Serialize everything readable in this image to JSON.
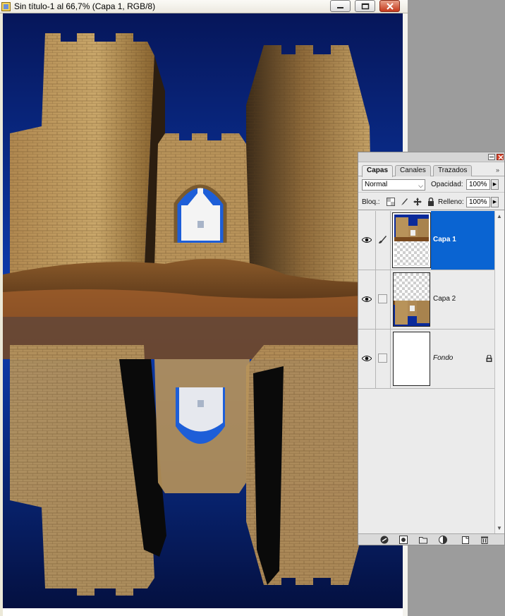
{
  "window": {
    "title": "Sin título-1 al 66,7% (Capa 1, RGB/8)"
  },
  "layers_panel": {
    "tabs": [
      {
        "label": "Capas",
        "active": true
      },
      {
        "label": "Canales",
        "active": false
      },
      {
        "label": "Trazados",
        "active": false
      }
    ],
    "blend_mode": "Normal",
    "opacity_label": "Opacidad:",
    "opacity_value": "100%",
    "lock_label": "Bloq.:",
    "fill_label": "Relleno:",
    "fill_value": "100%",
    "layers": [
      {
        "name": "Capa 1",
        "selected": true,
        "visible": true,
        "locked": false
      },
      {
        "name": "Capa 2",
        "selected": false,
        "visible": true,
        "locked": false
      },
      {
        "name": "Fondo",
        "selected": false,
        "visible": true,
        "locked": true
      }
    ],
    "bottom_icons": [
      "link-layers-icon",
      "layer-style-icon",
      "layer-mask-icon",
      "new-group-icon",
      "adjustment-layer-icon",
      "new-layer-icon",
      "trash-icon"
    ]
  },
  "colors": {
    "selection": "#0a64d2",
    "sky": "#0a2a9a",
    "close_button": "#c5391c"
  }
}
